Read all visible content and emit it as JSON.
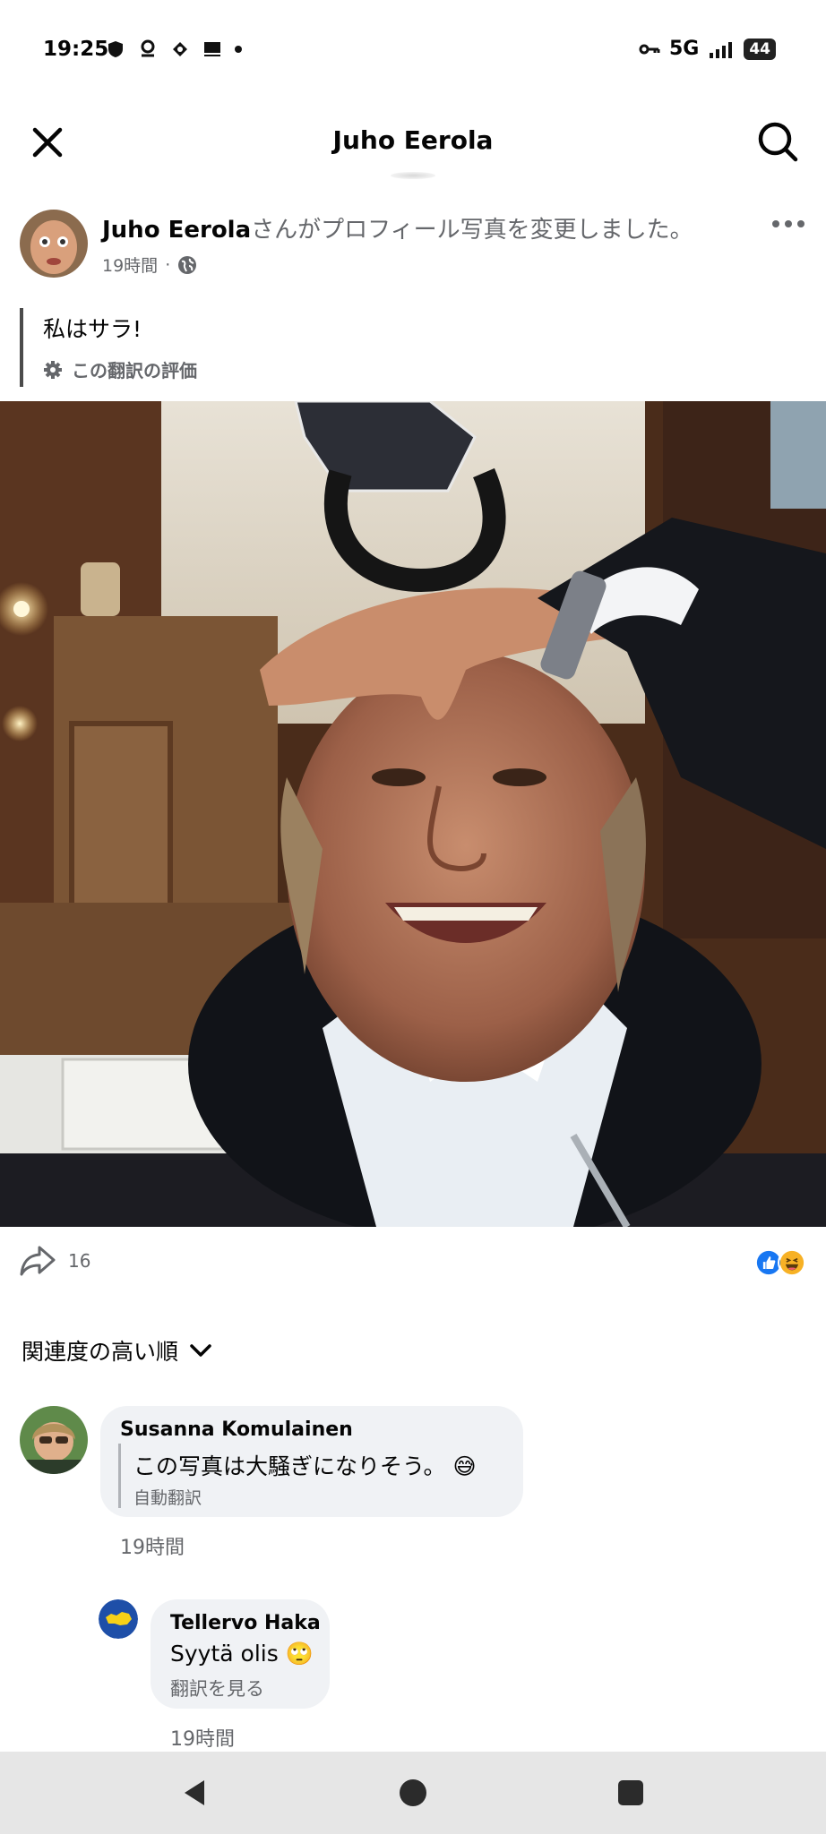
{
  "status_bar": {
    "time": "19:25",
    "network": "5G",
    "battery": "44"
  },
  "header": {
    "title": "Juho Eerola"
  },
  "post": {
    "author": "Juho Eerola",
    "action_text": "さんがプロフィール写真を変更しました。",
    "time": "19時間",
    "separator": "·",
    "caption": "私はサラ!",
    "rate_translation": "この翻訳の評価"
  },
  "actions": {
    "share_count": "16"
  },
  "sort": {
    "label": "関連度の高い順"
  },
  "comments": [
    {
      "author": "Susanna Komulainen",
      "text": "この写真は大騒ぎになりそう。 😅",
      "sub_label": "自動翻訳",
      "time": "19時間"
    },
    {
      "author": "Tellervo Haka",
      "text": "Syytä olis 🙄",
      "sub_label": "翻訳を見る",
      "time": "19時間"
    }
  ],
  "colors": {
    "like_blue": "#1877f2",
    "haha_yellow": "#f7b125",
    "secondary_text": "#65676b",
    "bubble_bg": "#f0f2f5"
  },
  "icons": [
    "close-icon",
    "search-icon",
    "more-icon",
    "globe-icon",
    "gear-icon",
    "share-icon",
    "like-reaction-icon",
    "haha-reaction-icon",
    "chevron-down-icon",
    "back-icon",
    "home-icon",
    "recents-icon"
  ]
}
